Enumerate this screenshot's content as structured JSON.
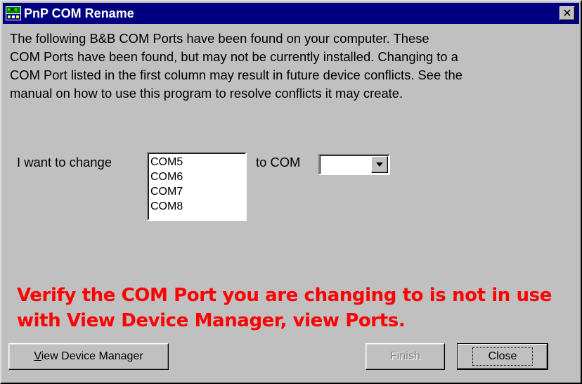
{
  "window": {
    "title": "PnP COM Rename",
    "close_glyph": "✕"
  },
  "description": "The following B&B COM Ports have been found on your computer.  These\nCOM Ports have been found, but may not be currently installed.  Changing to a\nCOM Port listed in the first column may result in future device conflicts.  See the\nmanual on how to use this program to resolve conflicts it may create.",
  "form": {
    "change_label": "I want to change",
    "to_label": "to COM",
    "ports": [
      "COM5",
      "COM6",
      "COM7",
      "COM8"
    ],
    "to_com_value": ""
  },
  "warning": {
    "line1": "Verify the COM Port you are changing to is not in use",
    "line2": "with View Device Manager, view Ports."
  },
  "buttons": {
    "view_device_manager": "View Device Manager",
    "finish": "Finish",
    "close": "Close"
  },
  "colors": {
    "titlebar": "#000080",
    "face": "#c0c0c0",
    "warning": "#ff0000"
  },
  "icons": [
    "app-icon",
    "close-icon",
    "dropdown-arrow-icon"
  ]
}
